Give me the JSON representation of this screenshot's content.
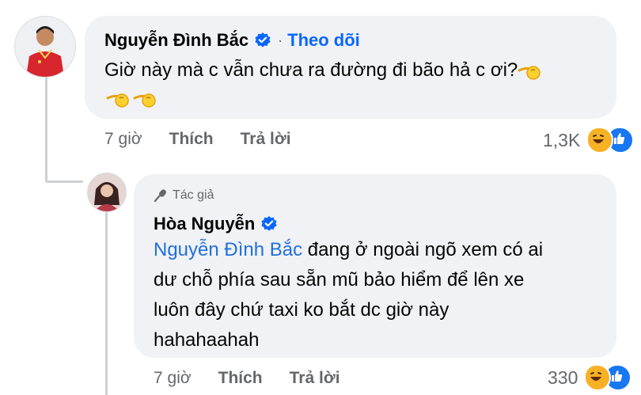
{
  "comment": {
    "author": "Nguyễn Đình Bắc",
    "follow_label": "Theo dõi",
    "dot": "·",
    "text": "Giờ này mà c vẫn chưa ra đường đi bão hả c ơi?",
    "time": "7 giờ",
    "like_label": "Thích",
    "reply_label": "Trả lời",
    "reaction_count": "1,3K"
  },
  "reply": {
    "author_badge": "Tác giả",
    "author": "Hòa Nguyễn",
    "mention": "Nguyễn Đình Bắc",
    "text_line1": " đang ở ngoài ngõ xem có ai",
    "text_line2": "dư chỗ phía sau sẵn mũ bảo hiểm để lên xe",
    "text_line3": "luôn đây chứ taxi ko bắt dc giờ này",
    "text_line4": "hahahaahah",
    "time": "7 giờ",
    "like_label": "Thích",
    "reply_label": "Trả lời",
    "reaction_count": "330"
  },
  "icons": {
    "verified": "verified-badge-icon",
    "emoji": "pointing-hand-emoji",
    "haha": "haha-reaction-icon",
    "like": "like-reaction-icon",
    "microphone": "microphone-icon"
  },
  "colors": {
    "link": "#216fdb",
    "follow": "#0866ff",
    "bubble": "#f0f2f5",
    "secondary_text": "#65676b"
  }
}
